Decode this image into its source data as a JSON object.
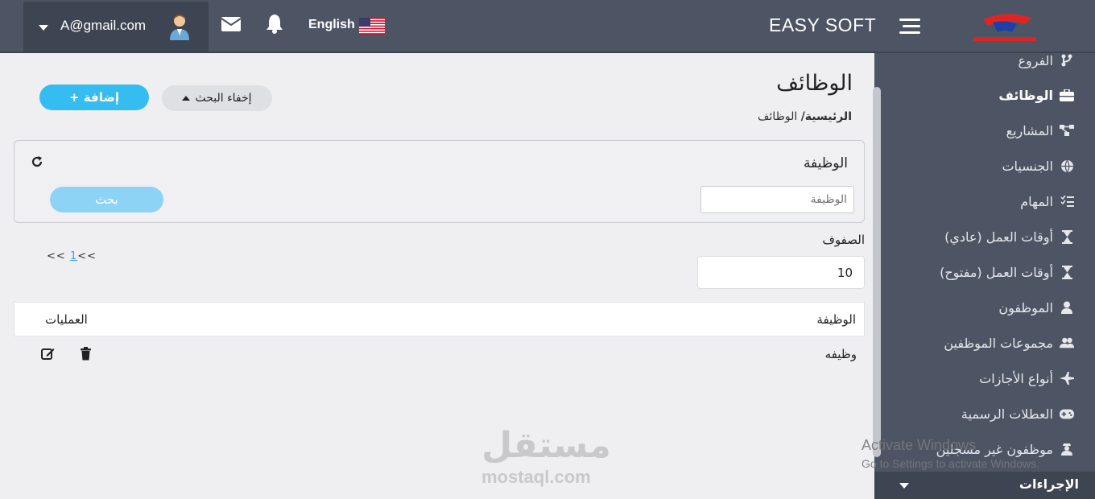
{
  "header": {
    "user_email": "A@gmail.com",
    "language": "English",
    "brand": "EASY SOFT"
  },
  "sidebar": {
    "items": [
      {
        "label": "الفروع",
        "icon": "branch-icon"
      },
      {
        "label": "الوظائف",
        "icon": "briefcase-icon",
        "active": true
      },
      {
        "label": "المشاريع",
        "icon": "project-icon"
      },
      {
        "label": "الجنسيات",
        "icon": "globe-icon"
      },
      {
        "label": "المهام",
        "icon": "tasks-icon"
      },
      {
        "label": "أوقات العمل (عادي)",
        "icon": "hourglass-icon"
      },
      {
        "label": "أوقات العمل (مفتوح)",
        "icon": "hourglass-icon"
      },
      {
        "label": "الموظفون",
        "icon": "user-icon"
      },
      {
        "label": "مجموعات الموظفين",
        "icon": "users-icon"
      },
      {
        "label": "أنواع الأجازات",
        "icon": "plane-icon"
      },
      {
        "label": "العطلات الرسمية",
        "icon": "gamepad-icon"
      },
      {
        "label": "موظفون غير مسجلين",
        "icon": "user-secret-icon"
      }
    ],
    "footer_label": "الإجراءات"
  },
  "page": {
    "title": "الوظائف",
    "breadcrumb_home": "الرئيسية/",
    "breadcrumb_current": "الوظائف",
    "hide_search_label": "إخفاء البحث",
    "add_label": "إضافة +"
  },
  "search": {
    "label": "الوظيفة",
    "placeholder": "الوظيفة",
    "button_label": "بحث"
  },
  "rows": {
    "label": "الصفوف",
    "value": "10"
  },
  "pager": {
    "prev": "<<",
    "page": "1",
    "next": "<<"
  },
  "table": {
    "columns": [
      "الوظيفة",
      "العمليات"
    ],
    "rows": [
      {
        "job": "وظيفه"
      }
    ]
  },
  "overlay": {
    "watermark": "مستقل",
    "watermark_sub": "mostaql.com",
    "activate_title": "Activate Windows",
    "activate_sub": "Go to Settings to activate Windows."
  },
  "colors": {
    "topbar": "#4d5565",
    "sidebar": "#4d5565",
    "accent": "#35bdf2",
    "search_button": "#8dd3f6"
  }
}
